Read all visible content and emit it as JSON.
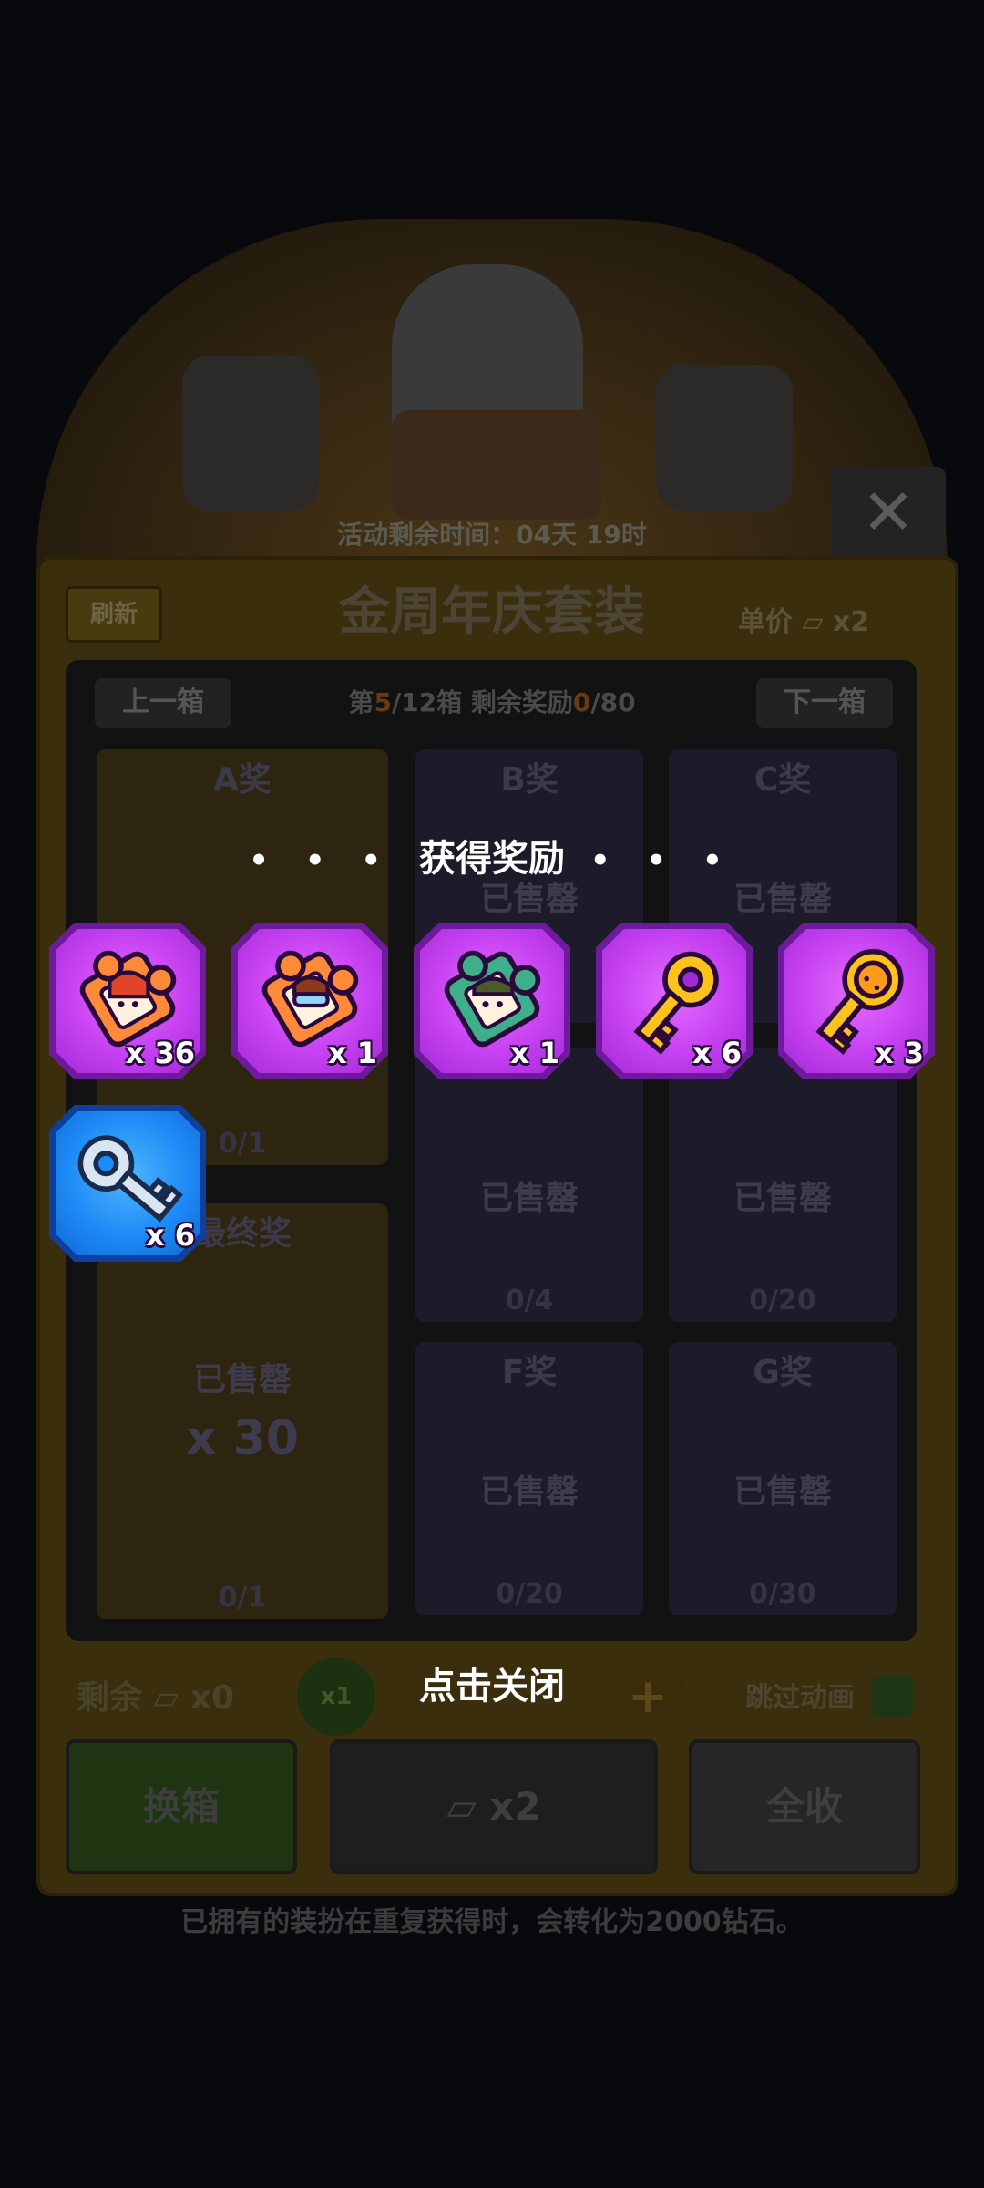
{
  "background": {
    "timer": "活动剩余时间：04天 19时",
    "refresh_label": "刷新",
    "title": "金周年庆套装",
    "unit_price_label": "单价",
    "unit_price_qty": "x2",
    "prev_box": "上一箱",
    "next_box": "下一箱",
    "box_info": {
      "prefix": "第",
      "current": "5",
      "middle": "/12箱  剩余奖励",
      "remaining": "0",
      "suffix": "/80"
    },
    "prizes": [
      {
        "label": "A奖",
        "count": "0/1"
      },
      {
        "label": "B奖",
        "status": "已售罄",
        "count": ""
      },
      {
        "label": "C奖",
        "status": "已售罄",
        "count": ""
      },
      {
        "label": "",
        "status": "已售罄",
        "count": "0/4"
      },
      {
        "label": "",
        "status": "已售罄",
        "count": "0/20"
      },
      {
        "label": "最终奖",
        "status": "已售罄",
        "qty": "x 30",
        "count": "0/1"
      },
      {
        "label": "F奖",
        "status": "已售罄",
        "count": "0/20"
      },
      {
        "label": "G奖",
        "status": "已售罄",
        "count": "0/30"
      }
    ],
    "remaining_label": "剩余",
    "remaining_qty": "x0",
    "x1_label": "x1",
    "skip_animation_label": "跳过动画",
    "change_box_button": "换箱",
    "draw_qty": "x2",
    "collect_all_button": "全收",
    "footer_note": "已拥有的装扮在重复获得时，会转化为2000钻石。"
  },
  "reward_popup": {
    "dots_left": "• • •",
    "title": "获得奖励",
    "dots_right": "• • •",
    "items": [
      {
        "icon": "puzzle-red-hair-icon",
        "qty": "x 36",
        "rarity": "purple"
      },
      {
        "icon": "puzzle-goggles-icon",
        "qty": "x 1",
        "rarity": "purple"
      },
      {
        "icon": "puzzle-soldier-icon",
        "qty": "x 1",
        "rarity": "purple"
      },
      {
        "icon": "gold-key-icon",
        "qty": "x 6",
        "rarity": "purple"
      },
      {
        "icon": "gold-cat-key-icon",
        "qty": "x 3",
        "rarity": "purple"
      },
      {
        "icon": "silver-key-icon",
        "qty": "x 6",
        "rarity": "blue"
      }
    ],
    "close_hint": "点击关闭"
  },
  "colors": {
    "overlay": "#07090c",
    "purple_tile": "#c641f1",
    "blue_tile": "#1e8cf6",
    "puzzle_orange": "#ff8a3a",
    "puzzle_green": "#3fae8a",
    "key_gold": "#ffc21a"
  }
}
